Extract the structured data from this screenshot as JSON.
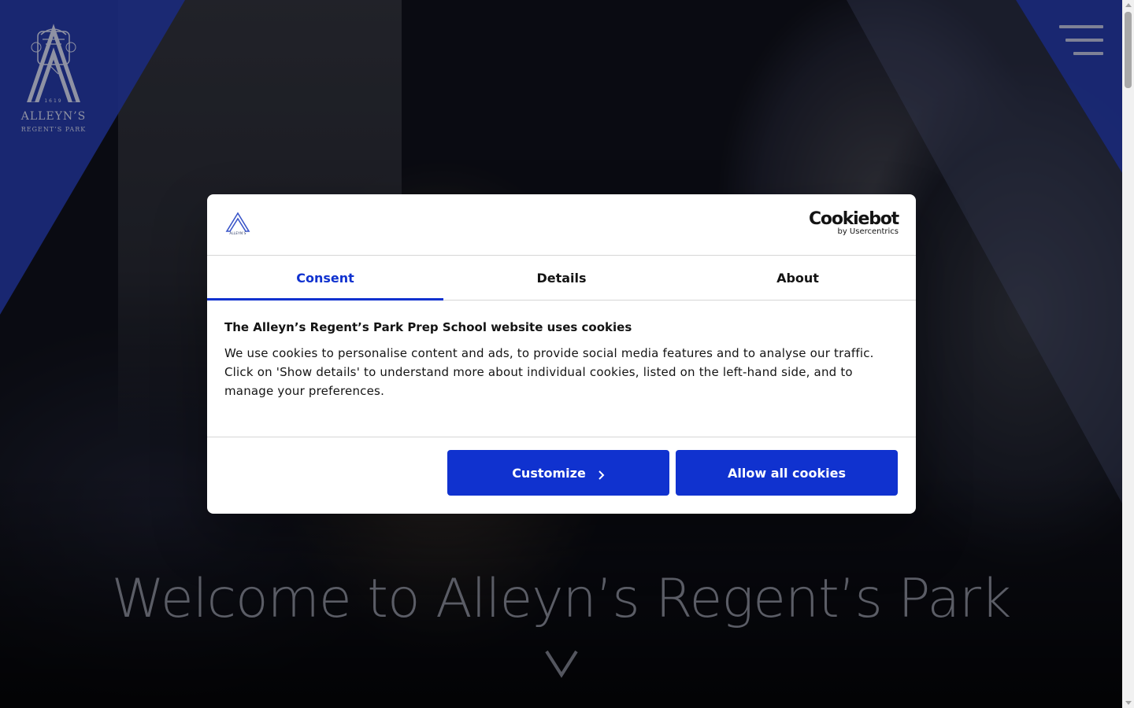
{
  "site": {
    "logo": {
      "name": "ALLEYN’S",
      "subtitle": "REGENT’S PARK",
      "year": "1619",
      "icon": "crest-icon"
    },
    "menu_icon": "hamburger-menu-icon",
    "hero": {
      "title": "Welcome to Alleyn’s Regent’s Park",
      "scroll_icon": "chevron-down-icon"
    }
  },
  "cookie_dialog": {
    "logo_label": "ALLEYN’S",
    "provider": {
      "name": "Cookiebot",
      "byline": "by Usercentrics"
    },
    "tabs": [
      {
        "label": "Consent",
        "active": true
      },
      {
        "label": "Details",
        "active": false
      },
      {
        "label": "About",
        "active": false
      }
    ],
    "heading": "The Alleyn’s Regent’s Park Prep School website uses cookies",
    "body": "We use cookies to personalise content and ads, to provide social media features and to analyse our traffic. Click on 'Show details' to understand more about individual cookies, listed on the left-hand side, and to manage your preferences.",
    "buttons": {
      "customize": "Customize",
      "allow_all": "Allow all cookies"
    }
  },
  "colors": {
    "brand_blue": "#1032cf",
    "stripe_blue": "#1b2a7a",
    "text": "#141414"
  }
}
